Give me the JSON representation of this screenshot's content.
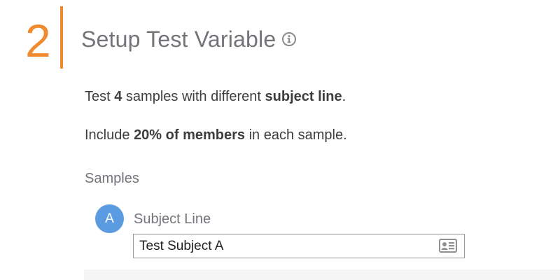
{
  "step": {
    "number": "2",
    "title": "Setup Test Variable"
  },
  "summary": {
    "line1": {
      "prefix": "Test ",
      "count": "4",
      "middle": " samples with different ",
      "variable": "subject line",
      "suffix": "."
    },
    "line2": {
      "prefix": "Include ",
      "emphasis": "20% of members",
      "suffix": " in each sample."
    }
  },
  "samples": {
    "heading": "Samples",
    "items": [
      {
        "badge": "A",
        "label": "Subject Line",
        "value": "Test Subject A"
      }
    ]
  },
  "icons": {
    "info": "info-circle-icon",
    "merge_tag": "contact-card-icon"
  },
  "colors": {
    "accent": "#f08a2c",
    "badge": "#5b9bdf",
    "muted_text": "#73737a",
    "body_text": "#3d3d3d"
  }
}
